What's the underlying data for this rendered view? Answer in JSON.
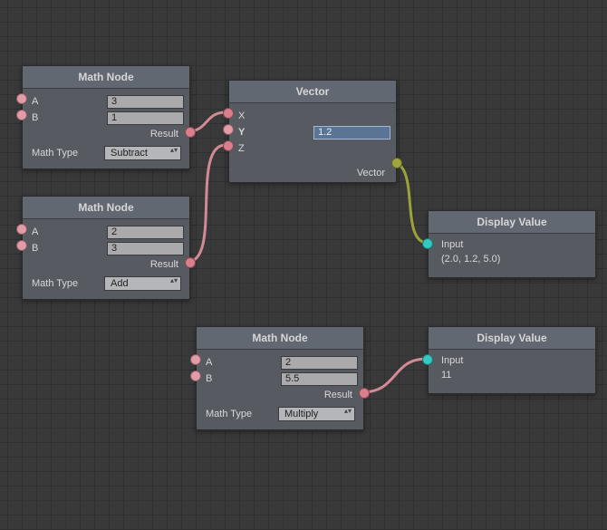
{
  "nodes": {
    "math1": {
      "title": "Math Node",
      "a_label": "A",
      "a_value": "3",
      "b_label": "B",
      "b_value": "1",
      "result_label": "Result",
      "type_label": "Math Type",
      "type_value": "Subtract"
    },
    "math2": {
      "title": "Math Node",
      "a_label": "A",
      "a_value": "2",
      "b_label": "B",
      "b_value": "3",
      "result_label": "Result",
      "type_label": "Math Type",
      "type_value": "Add"
    },
    "math3": {
      "title": "Math Node",
      "a_label": "A",
      "a_value": "2",
      "b_label": "B",
      "b_value": "5.5",
      "result_label": "Result",
      "type_label": "Math Type",
      "type_value": "Multiply"
    },
    "vector": {
      "title": "Vector",
      "x_label": "X",
      "y_label": "Y",
      "y_value": "1.2",
      "z_label": "Z",
      "out_label": "Vector"
    },
    "display1": {
      "title": "Display Value",
      "input_label": "Input",
      "value": "(2.0, 1.2, 5.0)"
    },
    "display2": {
      "title": "Display Value",
      "input_label": "Input",
      "value": "11"
    }
  },
  "colors": {
    "float_port": "#e19ca5",
    "vector_port": "#9fa63e",
    "any_port": "#35c7c2"
  }
}
